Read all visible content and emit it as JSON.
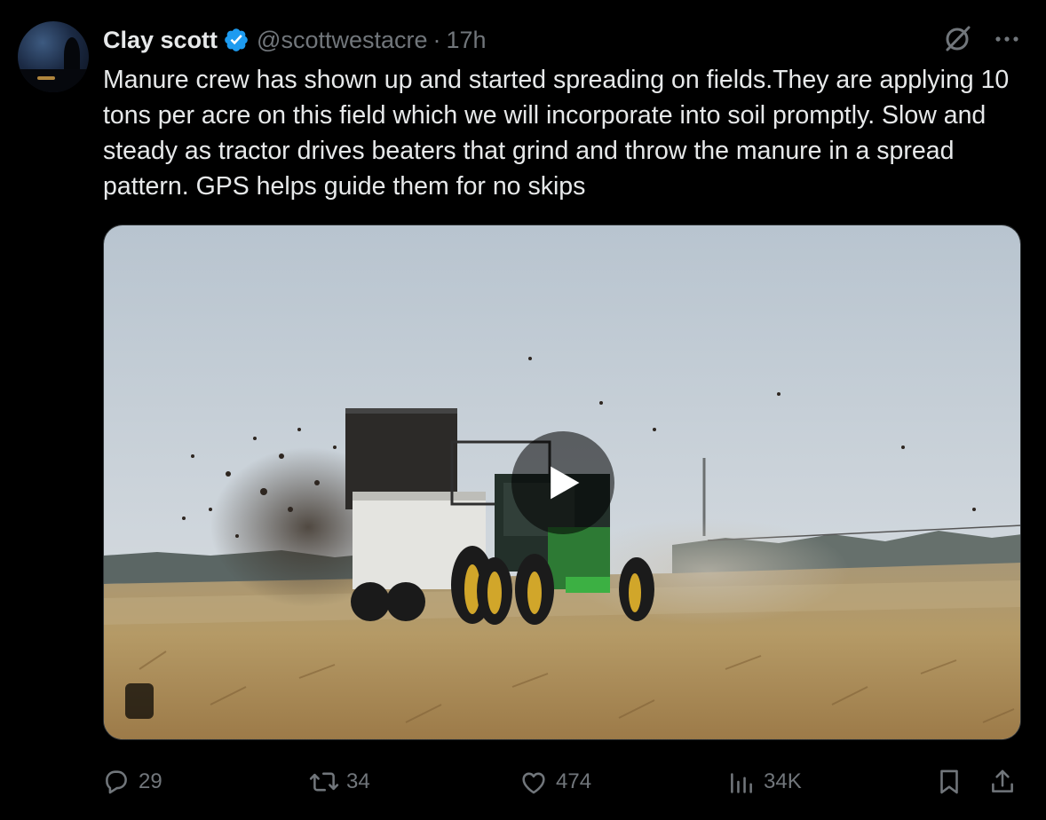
{
  "user": {
    "name": "Clay scott",
    "handle": "@scottwestacre",
    "separator": "·",
    "time": "17h",
    "verified_color": "#1d9bf0"
  },
  "tweet": {
    "text": "Manure crew has shown up and started spreading on fields.They are applying 10 tons per acre on this field which we will incorporate into soil promptly. Slow and steady as tractor drives beaters that grind and throw the manure in a spread pattern. GPS helps guide them for no skips"
  },
  "icons": {
    "header": [
      "verified-badge-icon",
      "grok-icon",
      "more-icon"
    ],
    "media": [
      "play-icon"
    ],
    "actions": [
      "reply-icon",
      "retweet-icon",
      "like-icon",
      "views-icon",
      "bookmark-icon",
      "share-icon"
    ]
  },
  "actions": {
    "replies": "29",
    "retweets": "34",
    "likes": "474",
    "views": "34K"
  },
  "colors": {
    "background": "#000000",
    "text": "#e7e9ea",
    "secondary": "#71767b",
    "accent": "#1d9bf0"
  }
}
